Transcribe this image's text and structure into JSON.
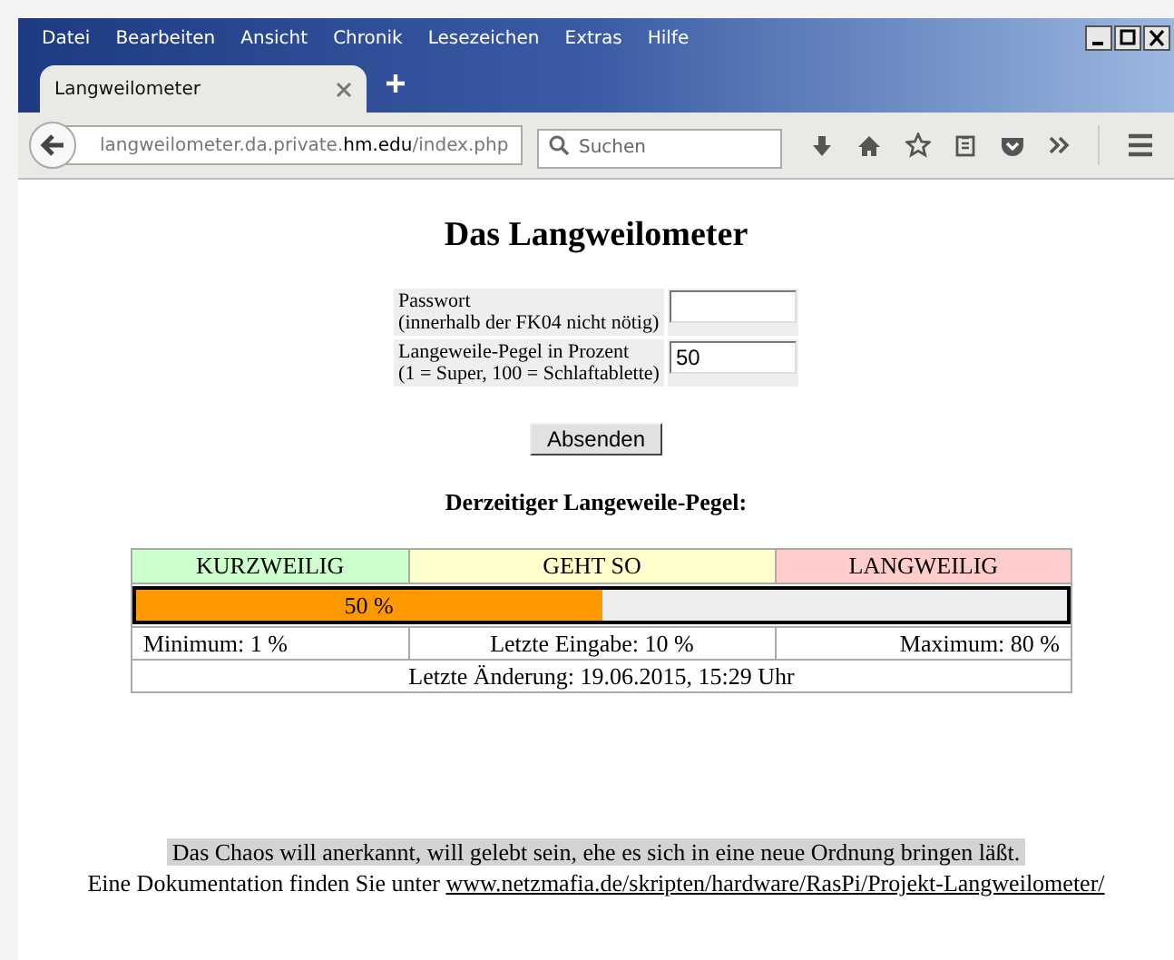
{
  "window": {
    "menu": [
      "Datei",
      "Bearbeiten",
      "Ansicht",
      "Chronik",
      "Lesezeichen",
      "Extras",
      "Hilfe"
    ]
  },
  "tabs": [
    {
      "label": "Langweilometer",
      "selected": true
    }
  ],
  "address_bar": {
    "url": "langweilometer.da.private.**hm.edu**/index.php"
  },
  "search": {
    "placeholder": "Suchen"
  },
  "page": {
    "title": "Das Langweilometer",
    "form": [
      {
        "label": "Passwort",
        "hint": "(innerhalb der FK04 nicht nötig)"
      },
      {
        "label": "Langeweile-Pegel in Prozent",
        "hint": "(1 = Super, 100 = Schlaftablette)",
        "value": "50"
      }
    ],
    "submit": "Absenden",
    "subtitle": "Derzeitiger Langeweile-Pegel:",
    "scale": [
      {
        "label": "KURZWEILIG",
        "color": "#ccffcc"
      },
      {
        "label": "GEHT SO",
        "color": "#ffffcc"
      },
      {
        "label": "LANGWEILIG",
        "color": "#ffcccc"
      }
    ],
    "meter": {
      "level": 0.5,
      "reading": "50 %"
    },
    "stats": [
      "Minimum: 1 %",
      "Letzte Eingabe: 10 %",
      "Maximum: 80 %"
    ],
    "last_change": "Letzte Änderung: 19.06.2015, 15:29 Uhr",
    "quote": "Das Chaos will anerkannt, will gelebt sein, ehe es sich in eine neue Ordnung bringen läßt.",
    "doc_text": "Eine Dokumentation finden Sie unter",
    "doc_link": "www.netzmafia.de/skripten/hardware/RasPi/Projekt-Langweilometer/"
  }
}
